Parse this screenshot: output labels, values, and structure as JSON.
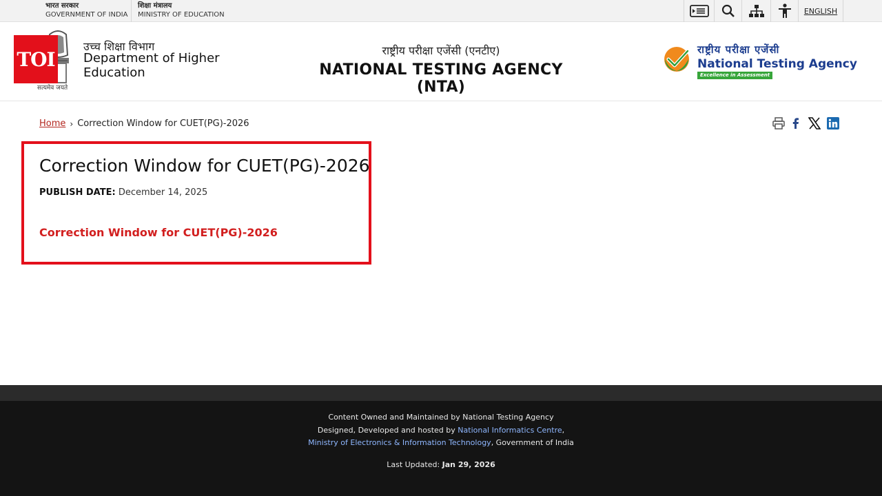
{
  "gov_bar": {
    "gov_hi": "भारत सरकार",
    "gov_en": "GOVERNMENT OF INDIA",
    "ministry_hi": "शिक्षा मंत्रालय",
    "ministry_en": "MINISTRY OF EDUCATION",
    "icons": [
      "skip-to-content-icon",
      "search-icon",
      "sitemap-icon",
      "accessibility-icon"
    ],
    "language": "ENGLISH"
  },
  "header": {
    "toi_badge": "TOI",
    "emblem_caption": "सत्यमेव जयते",
    "dept_hi": "उच्च शिक्षा विभाग",
    "dept_en_line1": "Department of Higher",
    "dept_en_line2": "Education",
    "nta_hi": "राष्ट्रीय परीक्षा एजेंसी (एनटीए)",
    "nta_en": "NATIONAL TESTING AGENCY (NTA)",
    "logo_hi": "राष्ट्रीय परीक्षा एजेंसी",
    "logo_en": "National Testing Agency",
    "logo_tag": "Excellence in Assessment"
  },
  "breadcrumb": {
    "home": "Home",
    "separator": "›",
    "current": "Correction Window for CUET(PG)-2026"
  },
  "share_icons": [
    "print-icon",
    "facebook-icon",
    "x-icon",
    "linkedin-icon"
  ],
  "content": {
    "title": "Correction Window for CUET(PG)-2026",
    "publish_label": "PUBLISH DATE:",
    "publish_date": "December 14, 2025",
    "link": "Correction Window for CUET(PG)-2026"
  },
  "footer": {
    "line1": "Content Owned and Maintained by National Testing Agency",
    "line2_prefix": "Designed, Developed and hosted by ",
    "line2_link": "National Informatics Centre",
    "line2_suffix": ",",
    "line3_link": "Ministry of Electronics & Information Technology",
    "line3_suffix": ", Government of India",
    "updated_label": "Last Updated: ",
    "updated_value": "Jan 29, 2026"
  },
  "colors": {
    "accent_red": "#e3101b",
    "link_red": "#d21f1f",
    "nta_blue": "#1c3d8f",
    "footer_bg": "#141414"
  }
}
